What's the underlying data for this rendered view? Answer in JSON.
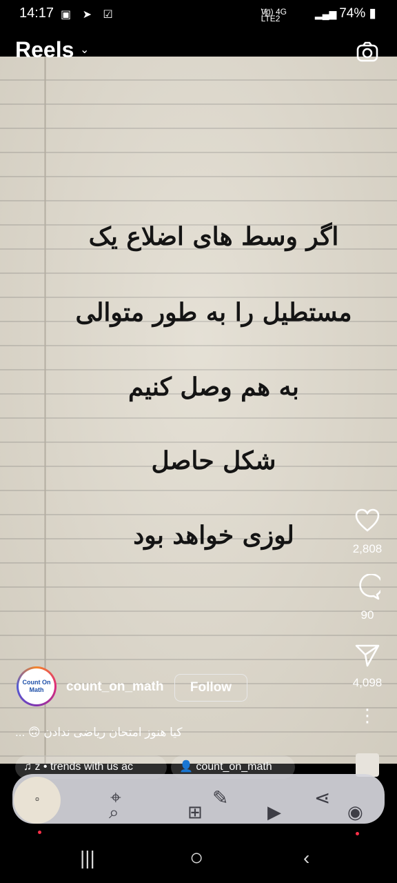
{
  "status_bar": {
    "time": "14:17",
    "battery": "74%",
    "network_top": "Vo) 4G",
    "network_bottom": "LTE2"
  },
  "header": {
    "title": "Reels"
  },
  "reel": {
    "poem_lines": [
      "اگر وسط های اضلاع یک",
      "مستطیل را به طور متوالی",
      "به هم وصل کنیم",
      "شکل حاصل",
      "لوزی خواهد بود"
    ]
  },
  "actions": {
    "likes": "2,808",
    "comments": "90",
    "shares": "4,098"
  },
  "author": {
    "username": "count_on_math",
    "follow_label": "Follow",
    "avatar_text": "Count On Math"
  },
  "caption": "کیا هنوز امتحان ریاضی ندادن 🙃 ...",
  "audio_pill": "z • trends with us   ac",
  "user_pill": "count_on_math",
  "colors": {
    "paper": "#e0dbcf",
    "text": "#141414",
    "badge": "#ff3048"
  }
}
